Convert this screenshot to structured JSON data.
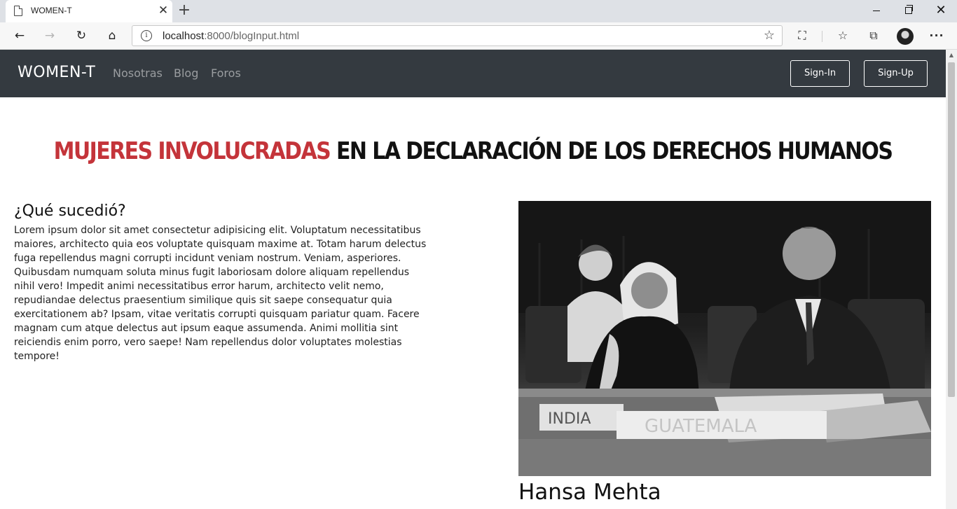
{
  "browser": {
    "tab_title": "WOMEN-T",
    "url_host": "localhost",
    "url_rest": ":8000/blogInput.html"
  },
  "nav": {
    "brand": "WOMEN-T",
    "links": [
      "Nosotras",
      "Blog",
      "Foros"
    ],
    "sign_in": "Sign-In",
    "sign_up": "Sign-Up"
  },
  "main": {
    "headline_accent": "MUJERES INVOLUCRADAS",
    "headline_rest": " EN LA DECLARACIÓN DE LOS DERECHOS HUMANOS",
    "section_title": "¿Qué sucedió?",
    "body": "Lorem ipsum dolor sit amet consectetur adipisicing elit. Voluptatum necessitatibus maiores, architecto quia eos voluptate quisquam maxime at. Totam harum delectus fuga repellendus magni corrupti incidunt veniam nostrum. Veniam, asperiores. Quibusdam numquam soluta minus fugit laboriosam dolore aliquam repellendus nihil vero! Impedit animi necessitatibus error harum, architecto velit nemo, repudiandae delectus praesentium similique quis sit saepe consequatur quia exercitationem ab? Ipsam, vitae veritatis corrupti quisquam pariatur quam. Facere magnam cum atque delectus aut ipsum eaque assumenda. Animi mollitia sint reiciendis enim porro, vero saepe! Nam repellendus dolor voluptates molestias tempore!",
    "photo_sign_1": "INDIA",
    "photo_sign_2": "GUATEMALA",
    "caption": "Hansa Mehta"
  },
  "icons": {
    "back": "back-arrow-icon",
    "forward": "forward-arrow-icon",
    "reload": "reload-icon",
    "home": "home-icon",
    "info": "info-icon",
    "favorite": "star-icon",
    "capture": "screen-capture-icon",
    "favorites": "favorites-list-icon",
    "collections": "collections-icon",
    "profile": "profile-avatar-icon",
    "more": "more-options-icon"
  }
}
